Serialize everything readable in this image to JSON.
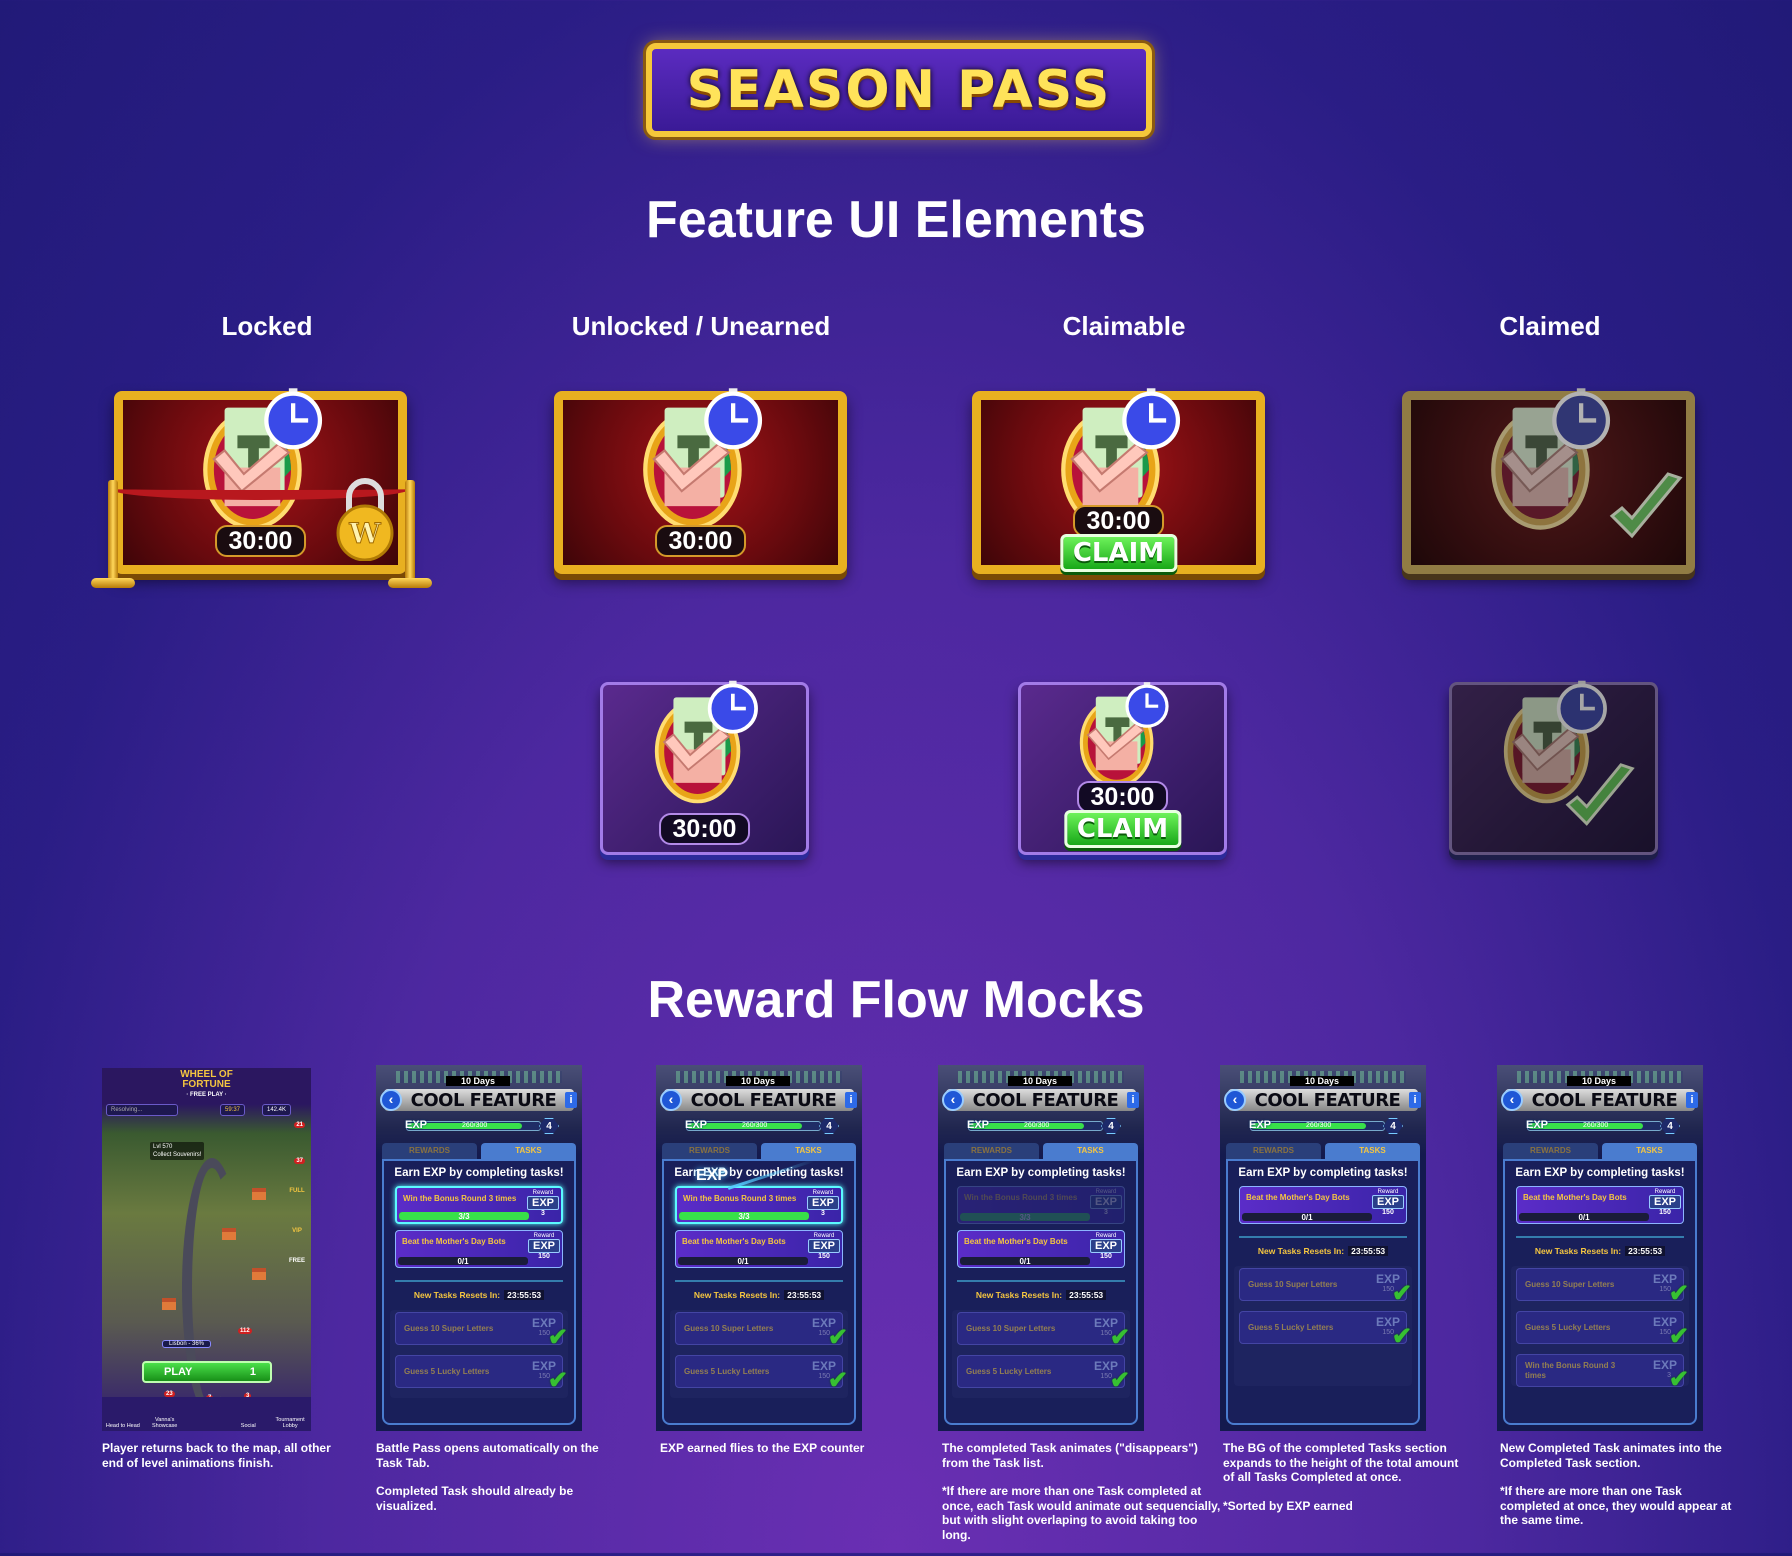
{
  "banner": {
    "title": "SEASON PASS"
  },
  "feature": {
    "title": "Feature UI Elements",
    "columns": [
      {
        "label": "Locked"
      },
      {
        "label": "Unlocked / Unearned"
      },
      {
        "label": "Claimable"
      },
      {
        "label": "Claimed"
      }
    ],
    "timer": "30:00",
    "claim_label": "CLAIM",
    "colors": {
      "gold": "#e8b020",
      "tile_red": "#8a0d12",
      "claim_green": "#2cc62a",
      "check_green": "#3cdc2a"
    }
  },
  "flow": {
    "title": "Reward Flow Mocks",
    "game": {
      "logo_line1": "WHEEL OF",
      "logo_line2": "FORTUNE",
      "logo_sub": "· FREE PLAY ·",
      "status": "Resolving...",
      "timer": "59:37",
      "coins": "142.4K",
      "level": "Lvl 570",
      "level_sub": "Collect Souvenirs!",
      "city": "Lisbon - 36%",
      "play": "PLAY",
      "tickets": "1",
      "badges": {
        "tasks": "21",
        "mail": "37",
        "book": "112",
        "showcase": "23",
        "center": "7",
        "social": "3"
      },
      "side": [
        "FULL",
        "VIP",
        "FREE"
      ],
      "nav": [
        "Head to Head",
        "Vanna's Showcase",
        "",
        "Social",
        "Tournament Lobby"
      ]
    },
    "panel": {
      "days": "10 Days",
      "title": "COOL FEATURE",
      "exp_label": "EXP",
      "exp_value": "260/300",
      "exp_fraction": 0.867,
      "level": "4",
      "tab_rewards": "REWARDS",
      "tab_tasks": "TASKS",
      "heading": "Earn EXP by completing tasks!",
      "reset_label": "New Tasks Resets In:",
      "reset_time": "23:55:53",
      "reward_label": "Reward",
      "exp": "EXP",
      "fly_label": "EXP"
    },
    "mocks": [
      {
        "active": [
          {
            "name": "Win the Bonus Round 3 times",
            "progress": "3/3",
            "fraction": 1,
            "reward": "3",
            "state": "complete"
          },
          {
            "name": "Beat the Mother's Day Bots",
            "progress": "0/1",
            "fraction": 0,
            "reward": "150",
            "state": "open"
          }
        ],
        "completed": [
          {
            "name": "Guess 10 Super Letters",
            "reward": "150"
          },
          {
            "name": "Guess 5 Lucky Letters",
            "reward": "150"
          }
        ],
        "fly": false,
        "expanded": false
      },
      {
        "active": [
          {
            "name": "Win the Bonus Round 3 times",
            "progress": "3/3",
            "fraction": 1,
            "reward": "3",
            "state": "complete"
          },
          {
            "name": "Beat the Mother's Day Bots",
            "progress": "0/1",
            "fraction": 0,
            "reward": "150",
            "state": "open"
          }
        ],
        "completed": [
          {
            "name": "Guess 10 Super Letters",
            "reward": "150"
          },
          {
            "name": "Guess 5 Lucky Letters",
            "reward": "150"
          }
        ],
        "fly": true,
        "expanded": false
      },
      {
        "active": [
          {
            "name": "Win the Bonus Round 3 times",
            "progress": "3/3",
            "fraction": 1,
            "reward": "3",
            "state": "fading"
          },
          {
            "name": "Beat the Mother's Day Bots",
            "progress": "0/1",
            "fraction": 0,
            "reward": "150",
            "state": "open"
          }
        ],
        "completed": [
          {
            "name": "Guess 10 Super Letters",
            "reward": "150"
          },
          {
            "name": "Guess 5 Lucky Letters",
            "reward": "150"
          }
        ],
        "fly": false,
        "expanded": false
      },
      {
        "active": [
          {
            "name": "Beat the Mother's Day Bots",
            "progress": "0/1",
            "fraction": 0,
            "reward": "150",
            "state": "open"
          }
        ],
        "completed": [
          {
            "name": "Guess 10 Super Letters",
            "reward": "150"
          },
          {
            "name": "Guess 5 Lucky Letters",
            "reward": "150"
          }
        ],
        "fly": false,
        "expanded": true
      },
      {
        "active": [
          {
            "name": "Beat the Mother's Day Bots",
            "progress": "0/1",
            "fraction": 0,
            "reward": "150",
            "state": "open"
          }
        ],
        "completed": [
          {
            "name": "Guess 10 Super Letters",
            "reward": "150"
          },
          {
            "name": "Guess 5 Lucky Letters",
            "reward": "150"
          },
          {
            "name": "Win the Bonus Round 3 times",
            "reward": "3"
          }
        ],
        "fly": false,
        "expanded": true
      }
    ],
    "captions": [
      [
        "Player returns back to the map, all other end of level animations finish."
      ],
      [
        "Battle Pass opens automatically on the Task Tab.",
        "Completed Task should already be visualized."
      ],
      [
        "EXP earned flies to the EXP counter"
      ],
      [
        "The completed Task animates (\"disappears\") from the Task list.",
        "*If there are more than one Task completed at once, each Task would animate out sequencially, but with slight overlaping to avoid taking too long."
      ],
      [
        "The BG of the completed Tasks section expands to the height of the total amount of all Tasks Completed at once.",
        "*Sorted by EXP earned"
      ],
      [
        "New Completed Task animates into the Completed Task section.",
        "*If there are more than one Task completed at once, they would appear at the same time."
      ]
    ]
  }
}
